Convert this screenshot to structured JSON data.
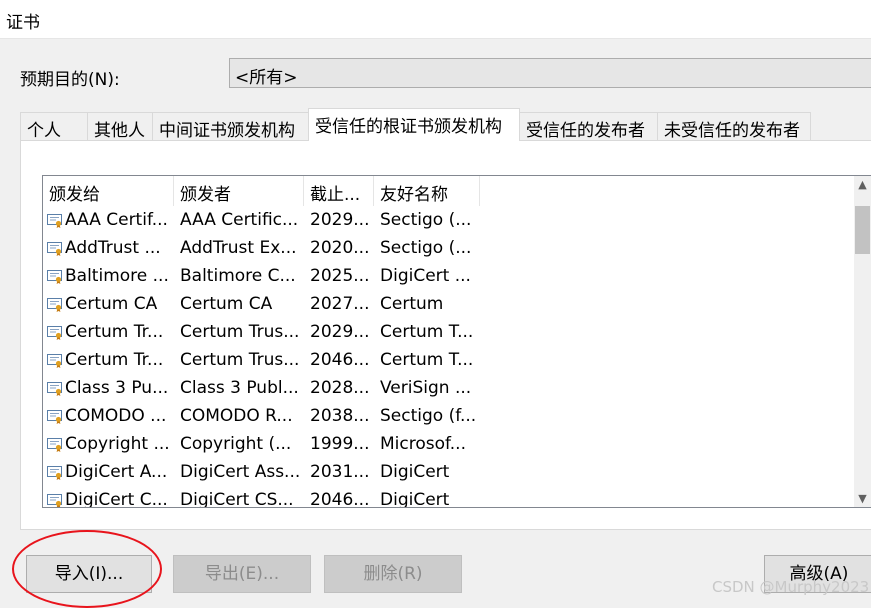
{
  "window": {
    "title": "证书"
  },
  "purpose": {
    "label": "预期目的(N):",
    "value": "<所有>"
  },
  "tabs": [
    {
      "label": "个人"
    },
    {
      "label": "其他人"
    },
    {
      "label": "中间证书颁发机构"
    },
    {
      "label": "受信任的根证书颁发机构"
    },
    {
      "label": "受信任的发布者"
    },
    {
      "label": "未受信任的发布者"
    }
  ],
  "table": {
    "columns": [
      "颁发给",
      "颁发者",
      "截止...",
      "友好名称"
    ],
    "rows": [
      [
        "AAA Certif...",
        "AAA Certific...",
        "2029...",
        "Sectigo (..."
      ],
      [
        "AddTrust ...",
        "AddTrust Ex...",
        "2020...",
        "Sectigo (..."
      ],
      [
        "Baltimore ...",
        "Baltimore C...",
        "2025...",
        "DigiCert ..."
      ],
      [
        "Certum CA",
        "Certum CA",
        "2027...",
        "Certum"
      ],
      [
        "Certum Tr...",
        "Certum Trus...",
        "2029...",
        "Certum T..."
      ],
      [
        "Certum Tr...",
        "Certum Trus...",
        "2046...",
        "Certum T..."
      ],
      [
        "Class 3 Pu...",
        "Class 3 Publ...",
        "2028...",
        "VeriSign ..."
      ],
      [
        "COMODO ...",
        "COMODO R...",
        "2038...",
        "Sectigo (f..."
      ],
      [
        "Copyright ...",
        "Copyright (...",
        "1999...",
        "Microsof..."
      ],
      [
        "DigiCert A...",
        "DigiCert Ass...",
        "2031...",
        "DigiCert"
      ],
      [
        "DigiCert C...",
        "DigiCert CS...",
        "2046...",
        "DigiCert"
      ]
    ]
  },
  "buttons": {
    "import": "导入(I)...",
    "export": "导出(E)...",
    "remove": "删除(R)",
    "advanced": "高级(A)"
  },
  "watermark": "CSDN @Murphy2023",
  "colors": {
    "highlight_circle": "#e8141c"
  }
}
